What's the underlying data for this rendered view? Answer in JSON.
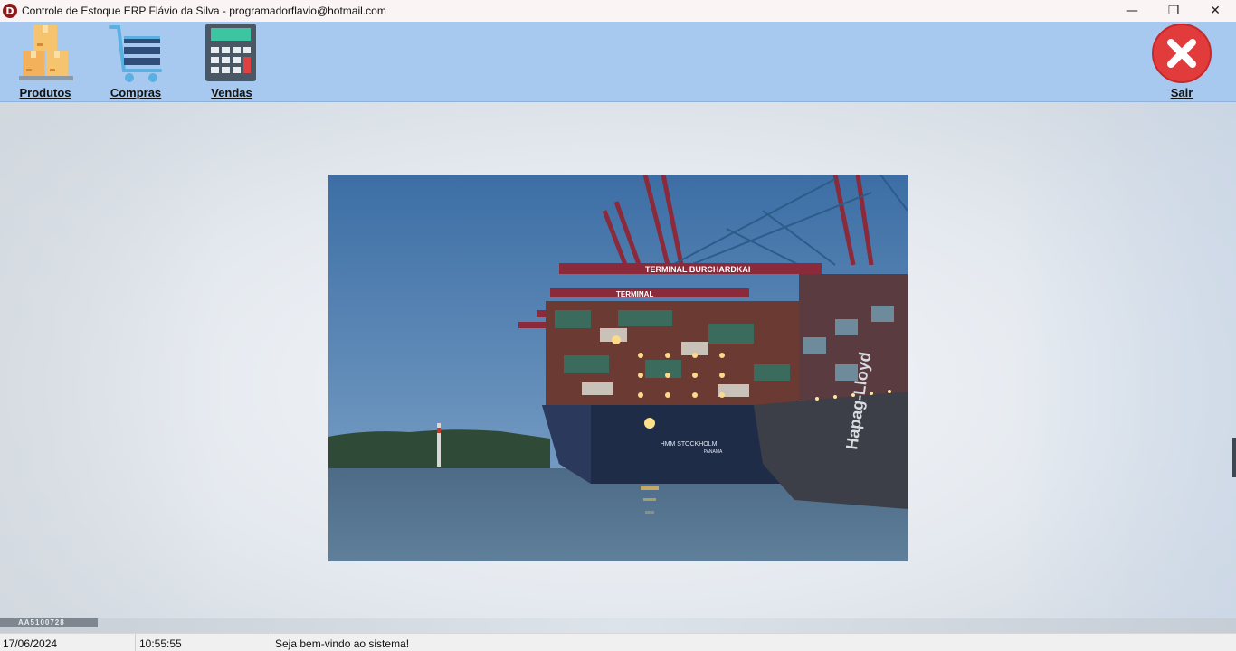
{
  "window": {
    "app_icon_letter": "D",
    "title": "Controle de Estoque ERP Flávio da Silva - programadorflavio@hotmail.com",
    "minimize_glyph": "—",
    "restore_glyph": "❐",
    "close_glyph": "✕"
  },
  "toolbar": {
    "produtos_label": "Produtos",
    "compras_label": "Compras",
    "vendas_label": "Vendas",
    "sair_label": "Sair",
    "icons": {
      "produtos": "boxes-icon",
      "compras": "shopping-cart-icon",
      "vendas": "calculator-icon",
      "sair": "close-circle-icon"
    }
  },
  "banner": {
    "terminal_sign_1": "TERMINAL BURCHARDKAI",
    "terminal_sign_2": "TERMINAL",
    "ship_name": "HMM STOCKHOLM",
    "ship_port": "PANAMA",
    "hull_brand": "Hapag-Lloyd"
  },
  "bottom_strip": {
    "tag_text": "AA5100728"
  },
  "status": {
    "date": "17/06/2024",
    "time": "10:55:55",
    "message": "Seja bem-vindo ao sistema!"
  },
  "colors": {
    "toolbar_bg": "#a7c9ef",
    "exit_red": "#e23b3b",
    "title_bg": "#fbf4f5"
  }
}
